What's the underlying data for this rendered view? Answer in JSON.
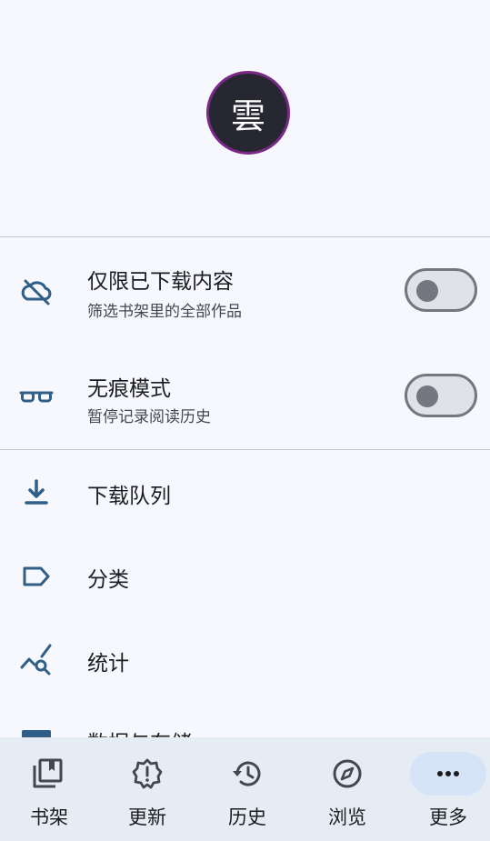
{
  "header": {
    "logo_text": "雲"
  },
  "toggles": [
    {
      "title": "仅限已下载内容",
      "subtitle": "筛选书架里的全部作品",
      "icon": "cloud-off-icon",
      "checked": false
    },
    {
      "title": "无痕模式",
      "subtitle": "暂停记录阅读历史",
      "icon": "glasses-icon",
      "checked": false
    }
  ],
  "menu": [
    {
      "label": "下载队列",
      "icon": "download-icon"
    },
    {
      "label": "分类",
      "icon": "label-icon"
    },
    {
      "label": "统计",
      "icon": "query-stats-icon"
    },
    {
      "label": "数据与存储",
      "icon": "storage-icon"
    }
  ],
  "bottom_nav": [
    {
      "label": "书架",
      "icon": "library-icon"
    },
    {
      "label": "更新",
      "icon": "new-releases-icon"
    },
    {
      "label": "历史",
      "icon": "history-icon"
    },
    {
      "label": "浏览",
      "icon": "explore-icon"
    },
    {
      "label": "更多",
      "icon": "more-horiz-icon",
      "selected": true
    }
  ],
  "colors": {
    "background": "#f7f8fd",
    "icon_blue": "#2f5f86",
    "nav_background": "#e6ecf4",
    "nav_active": "#d5e3f7",
    "logo_ring": "#7a2a86"
  }
}
